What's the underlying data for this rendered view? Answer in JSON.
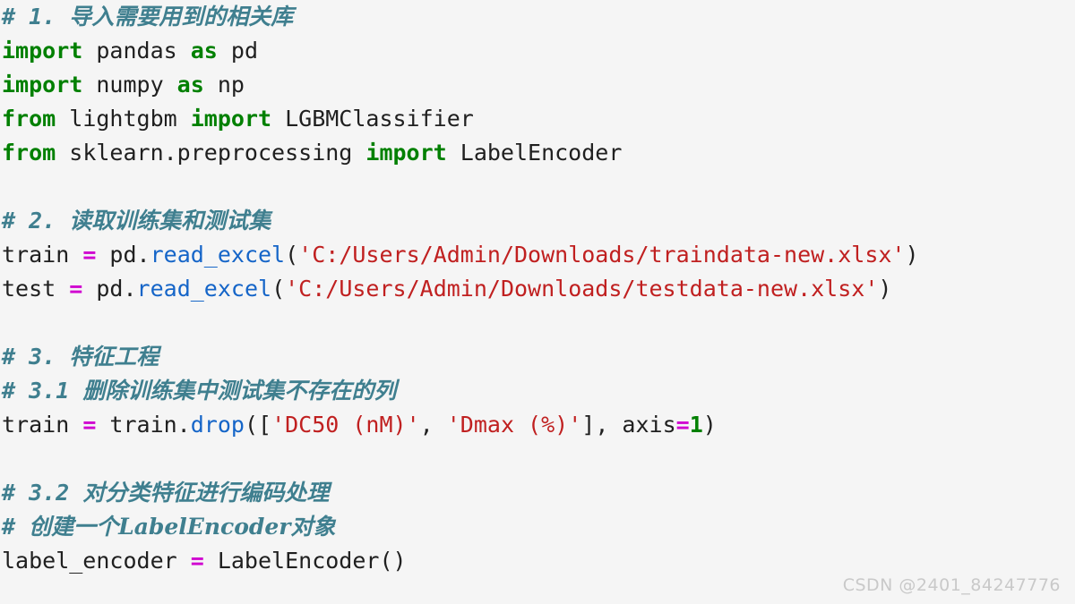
{
  "editor": {
    "background_color": "#f5f5f5",
    "language": "python",
    "font_size_px": 25,
    "line_height_px": 38
  },
  "theme": {
    "comment_color": "#3f7f8f",
    "keyword_color": "#008000",
    "string_color": "#c02020",
    "function_color": "#1565c8",
    "operator_color": "#d000d0",
    "number_color": "#008000",
    "plain_color": "#202020",
    "watermark_color": "#c9c9c9"
  },
  "watermark": {
    "text": "CSDN @2401_84247776"
  },
  "lines": [
    {
      "id": "line-1",
      "type": "comment",
      "hash": "# 1. ",
      "body": "导入需要用到的相关库"
    },
    {
      "id": "line-2",
      "type": "code",
      "tokens": [
        {
          "t": "keyword",
          "v": "import"
        },
        {
          "t": "plain",
          "v": " pandas "
        },
        {
          "t": "keyword",
          "v": "as"
        },
        {
          "t": "plain",
          "v": " pd"
        }
      ]
    },
    {
      "id": "line-3",
      "type": "code",
      "tokens": [
        {
          "t": "keyword",
          "v": "import"
        },
        {
          "t": "plain",
          "v": " numpy "
        },
        {
          "t": "keyword",
          "v": "as"
        },
        {
          "t": "plain",
          "v": " np"
        }
      ]
    },
    {
      "id": "line-4",
      "type": "code",
      "tokens": [
        {
          "t": "keyword",
          "v": "from"
        },
        {
          "t": "plain",
          "v": " lightgbm "
        },
        {
          "t": "keyword",
          "v": "import"
        },
        {
          "t": "plain",
          "v": " LGBMClassifier"
        }
      ]
    },
    {
      "id": "line-5",
      "type": "code",
      "tokens": [
        {
          "t": "keyword",
          "v": "from"
        },
        {
          "t": "plain",
          "v": " sklearn.preprocessing "
        },
        {
          "t": "keyword",
          "v": "import"
        },
        {
          "t": "plain",
          "v": " LabelEncoder"
        }
      ]
    },
    {
      "id": "line-6",
      "type": "blank"
    },
    {
      "id": "line-7",
      "type": "comment",
      "hash": "# 2. ",
      "body": "读取训练集和测试集"
    },
    {
      "id": "line-8",
      "type": "code",
      "tokens": [
        {
          "t": "plain",
          "v": "train "
        },
        {
          "t": "operator",
          "v": "="
        },
        {
          "t": "plain",
          "v": " pd."
        },
        {
          "t": "func",
          "v": "read_excel"
        },
        {
          "t": "punct",
          "v": "("
        },
        {
          "t": "string",
          "v": "'C:/Users/Admin/Downloads/traindata-new.xlsx'"
        },
        {
          "t": "punct",
          "v": ")"
        }
      ]
    },
    {
      "id": "line-9",
      "type": "code",
      "tokens": [
        {
          "t": "plain",
          "v": "test "
        },
        {
          "t": "operator",
          "v": "="
        },
        {
          "t": "plain",
          "v": " pd."
        },
        {
          "t": "func",
          "v": "read_excel"
        },
        {
          "t": "punct",
          "v": "("
        },
        {
          "t": "string",
          "v": "'C:/Users/Admin/Downloads/testdata-new.xlsx'"
        },
        {
          "t": "punct",
          "v": ")"
        }
      ]
    },
    {
      "id": "line-10",
      "type": "blank"
    },
    {
      "id": "line-11",
      "type": "comment",
      "hash": "# 3. ",
      "body": "特征工程"
    },
    {
      "id": "line-12",
      "type": "comment",
      "hash": "# 3.1 ",
      "body": "删除训练集中测试集不存在的列"
    },
    {
      "id": "line-13",
      "type": "code",
      "tokens": [
        {
          "t": "plain",
          "v": "train "
        },
        {
          "t": "operator",
          "v": "="
        },
        {
          "t": "plain",
          "v": " train."
        },
        {
          "t": "func",
          "v": "drop"
        },
        {
          "t": "punct",
          "v": "(["
        },
        {
          "t": "string",
          "v": "'DC50 (nM)'"
        },
        {
          "t": "punct",
          "v": ", "
        },
        {
          "t": "string",
          "v": "'Dmax (%)'"
        },
        {
          "t": "punct",
          "v": "], "
        },
        {
          "t": "plain",
          "v": "axis"
        },
        {
          "t": "operator",
          "v": "="
        },
        {
          "t": "number",
          "v": "1"
        },
        {
          "t": "punct",
          "v": ")"
        }
      ]
    },
    {
      "id": "line-14",
      "type": "blank"
    },
    {
      "id": "line-15",
      "type": "comment",
      "hash": "# 3.2 ",
      "body": "对分类特征进行编码处理"
    },
    {
      "id": "line-16",
      "type": "comment",
      "hash": "# ",
      "body": "创建一个LabelEncoder对象"
    },
    {
      "id": "line-17",
      "type": "code",
      "tokens": [
        {
          "t": "plain",
          "v": "label_encoder "
        },
        {
          "t": "operator",
          "v": "="
        },
        {
          "t": "plain",
          "v": " LabelEncoder()"
        }
      ]
    }
  ]
}
